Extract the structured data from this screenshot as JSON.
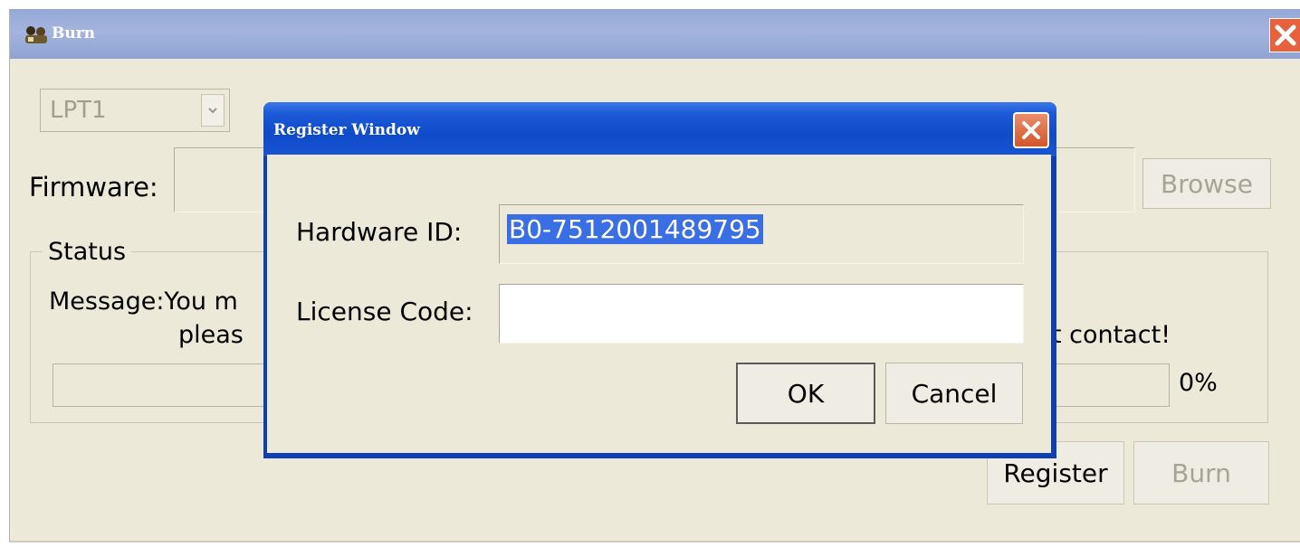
{
  "main_window": {
    "title": "Burn",
    "icon": "app-icon",
    "port": {
      "selected": "LPT1"
    },
    "firmware": {
      "label": "Firmware:",
      "value": "",
      "browse_label": "Browse"
    },
    "status": {
      "legend": "Status",
      "message_line1": "Message:You m",
      "message_line2": "pleas",
      "message_right": "t contact!",
      "progress_percent": 0,
      "progress_text": "0%"
    },
    "register_label": "Register",
    "burn_label": "Burn"
  },
  "dialog": {
    "title": "Register Window",
    "hardware_id_label": "Hardware ID:",
    "hardware_id_value": "B0-7512001489795",
    "license_code_label": "License Code:",
    "license_code_value": "",
    "ok_label": "OK",
    "cancel_label": "Cancel"
  },
  "colors": {
    "window_bg": "#ece9d8",
    "dialog_title": "#0f4ac8",
    "close_red": "#d4552a",
    "selection": "#3a6ee5",
    "disabled_text": "#a7a494"
  }
}
